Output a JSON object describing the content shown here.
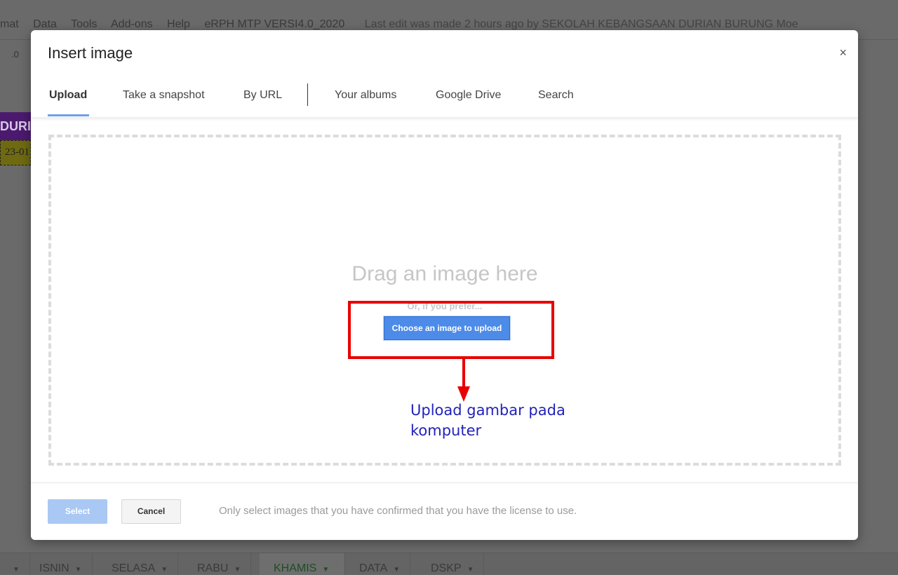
{
  "background": {
    "menu": [
      "mat",
      "Data",
      "Tools",
      "Add-ons",
      "Help",
      "eRPH MTP VERSI4.0_2020"
    ],
    "last_edit": "Last edit was made 2 hours ago by SEKOLAH KEBANGSAAN DURIAN BURUNG Moe",
    "toolbar_fragment": ".0",
    "cell_header": "DURIAN",
    "cell_date": "23-01"
  },
  "dialog": {
    "title": "Insert image",
    "close": "×",
    "tabs": [
      "Upload",
      "Take a snapshot",
      "By URL",
      "Your albums",
      "Google Drive",
      "Search"
    ],
    "drag_text": "Drag an image here",
    "prefer_text": "Or, if you prefer...",
    "choose_button": "Choose an image to upload",
    "annotation": "Upload gambar pada komputer",
    "select_button": "Select",
    "cancel_button": "Cancel",
    "license_note": "Only select images that you have confirmed that you have the license to use."
  },
  "sheet_tabs": [
    {
      "label": "ISNIN"
    },
    {
      "label": "SELASA"
    },
    {
      "label": "RABU"
    },
    {
      "label": "KHAMIS",
      "active": true
    },
    {
      "label": "DATA"
    },
    {
      "label": "DSKP"
    }
  ],
  "colors": {
    "accent": "#4c8be8",
    "annotation_red": "#e80000",
    "annotation_text": "#2222bb"
  }
}
